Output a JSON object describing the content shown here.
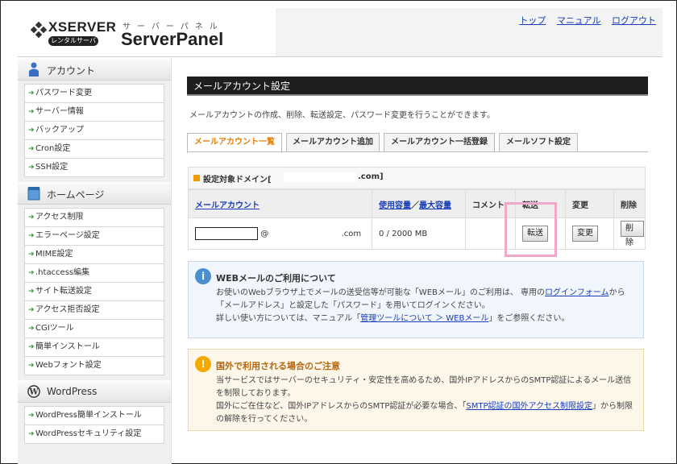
{
  "header": {
    "brand": "XSERVER",
    "brand_sub": "レンタルサーバー",
    "product_kana": "サーバーパネル",
    "product": "ServerPanel",
    "links": [
      "トップ",
      "マニュアル",
      "ログアウト"
    ]
  },
  "sidebar": {
    "sections": [
      {
        "title": "アカウント",
        "icon": "person-icon",
        "items": [
          "パスワード変更",
          "サーバー情報",
          "バックアップ",
          "Cron設定",
          "SSH設定"
        ]
      },
      {
        "title": "ホームページ",
        "icon": "page-icon",
        "items": [
          "アクセス制限",
          "エラーページ設定",
          "MIME設定",
          ".htaccess編集",
          "サイト転送設定",
          "アクセス拒否設定",
          "CGIツール",
          "簡単インストール",
          "Webフォント設定"
        ]
      },
      {
        "title": "WordPress",
        "icon": "wordpress-icon",
        "items": [
          "WordPress簡単インストール",
          "WordPressセキュリティ設定"
        ]
      }
    ]
  },
  "main": {
    "title": "メールアカウント設定",
    "description": "メールアカウントの作成、削除、転送設定、パスワード変更を行うことができます。",
    "tabs": [
      "メールアカウント一覧",
      "メールアカウント追加",
      "メールアカウント一括登録",
      "メールソフト設定"
    ],
    "domain_label": "設定対象ドメイン[",
    "domain_suffix": ".com]",
    "table": {
      "headers": [
        "メールアカウント",
        "使用容量",
        "／",
        "最大容量",
        "コメント",
        "転送",
        "変更",
        "削除"
      ],
      "row": {
        "at": "@",
        "domain_suffix": ".com",
        "usage": "0 / 2000 MB",
        "comment": "",
        "forward_btn": "転送",
        "change_btn": "変更",
        "delete_btn": "削除"
      }
    },
    "notice_webmail": {
      "title": "WEBメールのご利用について",
      "line1a": "お使いのWebブラウザ上でメールの送受信等が可能な「WEBメール」のご利用は、 専用の",
      "line1_link": "ログインフォーム",
      "line2b": "から「メールアドレス」と設定した「パスワード」を用いてログインください。",
      "line3a": "詳しい使い方については、マニュアル「",
      "line3_link": "管理ツールについて ＞ WEBメール",
      "line3b": "」をご参照ください。"
    },
    "notice_overseas": {
      "title": "国外で利用される場合のご注意",
      "line1": "当サービスではサーバーのセキュリティ・安定性を高めるため、国外IPアドレスからのSMTP認証によるメール送信を制限しております。",
      "line2a": "国外にご在住など、国外IPアドレスからのSMTP認証が必要な場合、「",
      "line2_link": "SMTP認証の国外アクセス制限設定",
      "line2b": "」から制限の解除を行ってください。"
    }
  },
  "colors": {
    "accent_orange": "#e67e00",
    "title_bar": "#1e1e1e",
    "highlight_pink": "#f0a8c8",
    "link_blue": "#1a3db8"
  }
}
